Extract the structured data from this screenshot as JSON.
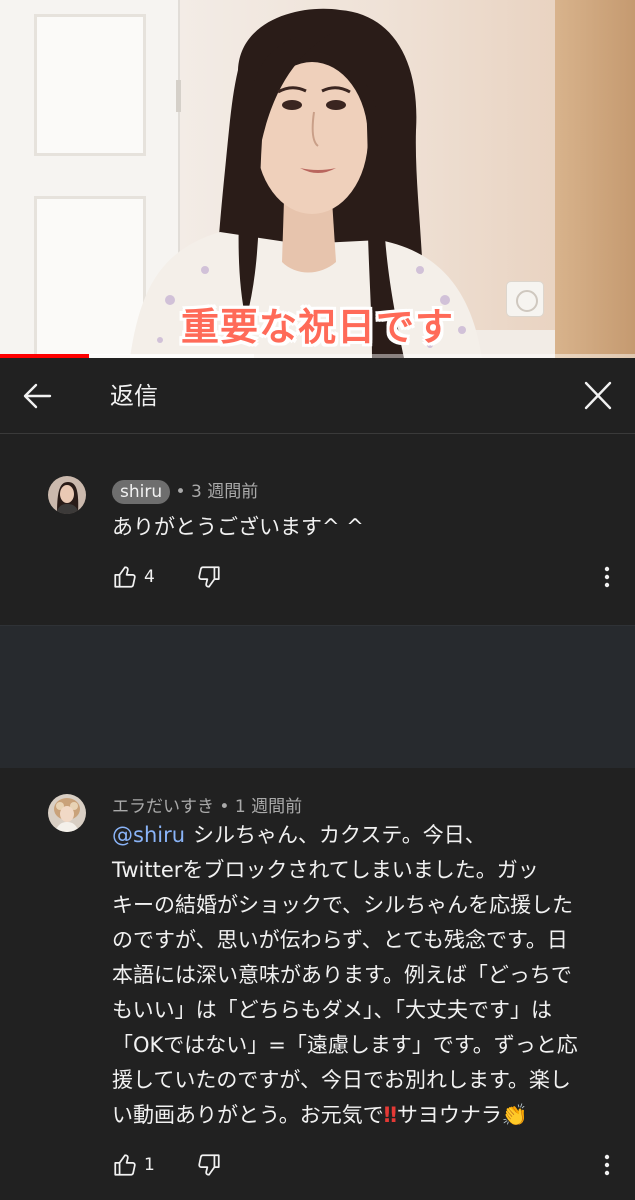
{
  "video": {
    "caption": "重要な祝日です",
    "progress_fraction": 0.14,
    "buffered_fraction": 0.4
  },
  "header": {
    "title": "返信",
    "back_icon": "arrow-left-icon",
    "close_icon": "close-icon"
  },
  "comments": [
    {
      "author": "shiru",
      "author_highlighted": true,
      "separator": "•",
      "time": "3 週間前",
      "mention": "",
      "text": "ありがとうございます^ ^",
      "likes": "4",
      "icons": [
        "thumb-up-icon",
        "thumb-down-icon",
        "more-vert-icon"
      ]
    },
    {
      "author": "エラだいすき",
      "author_highlighted": false,
      "separator": "•",
      "time": "1 週間前",
      "mention": "@shiru",
      "text_lines": [
        "シルちゃん、カクステ。今日、",
        "Twitterをブロックされてしまいました。ガッ",
        "キーの結婚がショックで、シルちゃんを応援した",
        "のですが、思いが伝わらず、とても残念です。日",
        "本語には深い意味があります。例えば「どっちで",
        "もいい」は「どちらもダメ」、「大丈夫です」は",
        "「OKではない」=「遠慮します」です。ずっと応",
        "援していたのですが、今日でお別れします。楽し",
        "い動画ありがとう。お元気で"
      ],
      "text_tail_bang": "‼",
      "text_tail_word": "サヨウナラ",
      "text_tail_clap": "👏",
      "likes": "1",
      "icons": [
        "thumb-up-icon",
        "thumb-down-icon",
        "more-vert-icon"
      ]
    }
  ],
  "colors": {
    "background": "#212121",
    "separator": "#272a2e",
    "mention": "#8ab4f8",
    "progress": "#ff0000",
    "caption": "#ff6a58"
  }
}
